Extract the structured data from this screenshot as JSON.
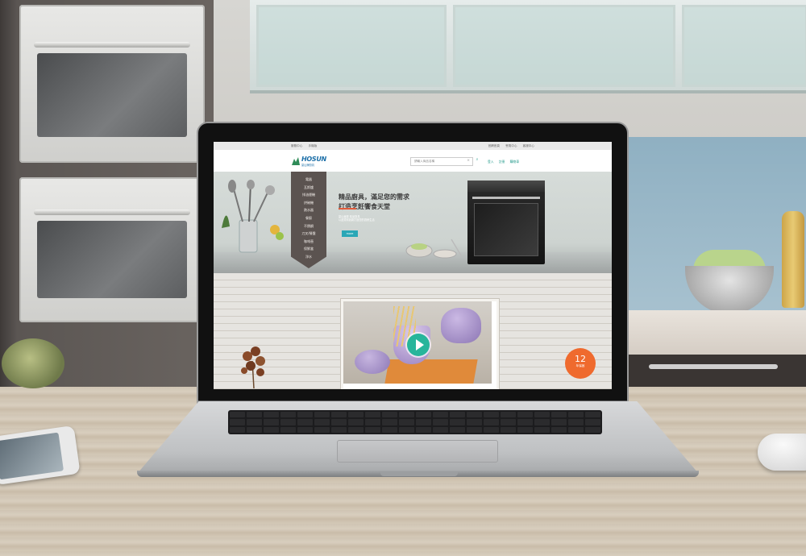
{
  "site": {
    "topbar": {
      "left_links": [
        "服務中心",
        "手機版"
      ],
      "right_links": [
        "官網首頁",
        "會員中心",
        "客服中心"
      ]
    },
    "logo": {
      "brand": "HOSUN",
      "subtitle": "豪山牌廚具"
    },
    "search": {
      "placeholder": "請輸入商品名稱"
    },
    "header_links": [
      "登入",
      "註冊",
      "購物車"
    ],
    "menu": {
      "items": [
        "電器",
        "瓦斯爐",
        "排油煙機",
        "烘碗機",
        "熱水器",
        "餐廚",
        "不銹鋼",
        "刀叉/餐盤",
        "咖啡壺",
        "保鮮盒",
        "淨水"
      ]
    },
    "hero": {
      "slogan_line1": "精品廚具，滿足您的需求",
      "slogan_line2": "打造烹飪饗食天堂",
      "desc_line1": "豪山嚴選 精品廚具",
      "desc_line2": "以品質和創新打造您的廚房生活",
      "button": "more"
    },
    "badge": {
      "number": "12",
      "text": "年保固"
    }
  },
  "colors": {
    "accent_teal": "#2aa7b6",
    "logo_blue": "#1c6fa8",
    "menu_bg": "#5b5350",
    "badge_orange": "#ef6a2e",
    "play_green": "#27b59b"
  }
}
